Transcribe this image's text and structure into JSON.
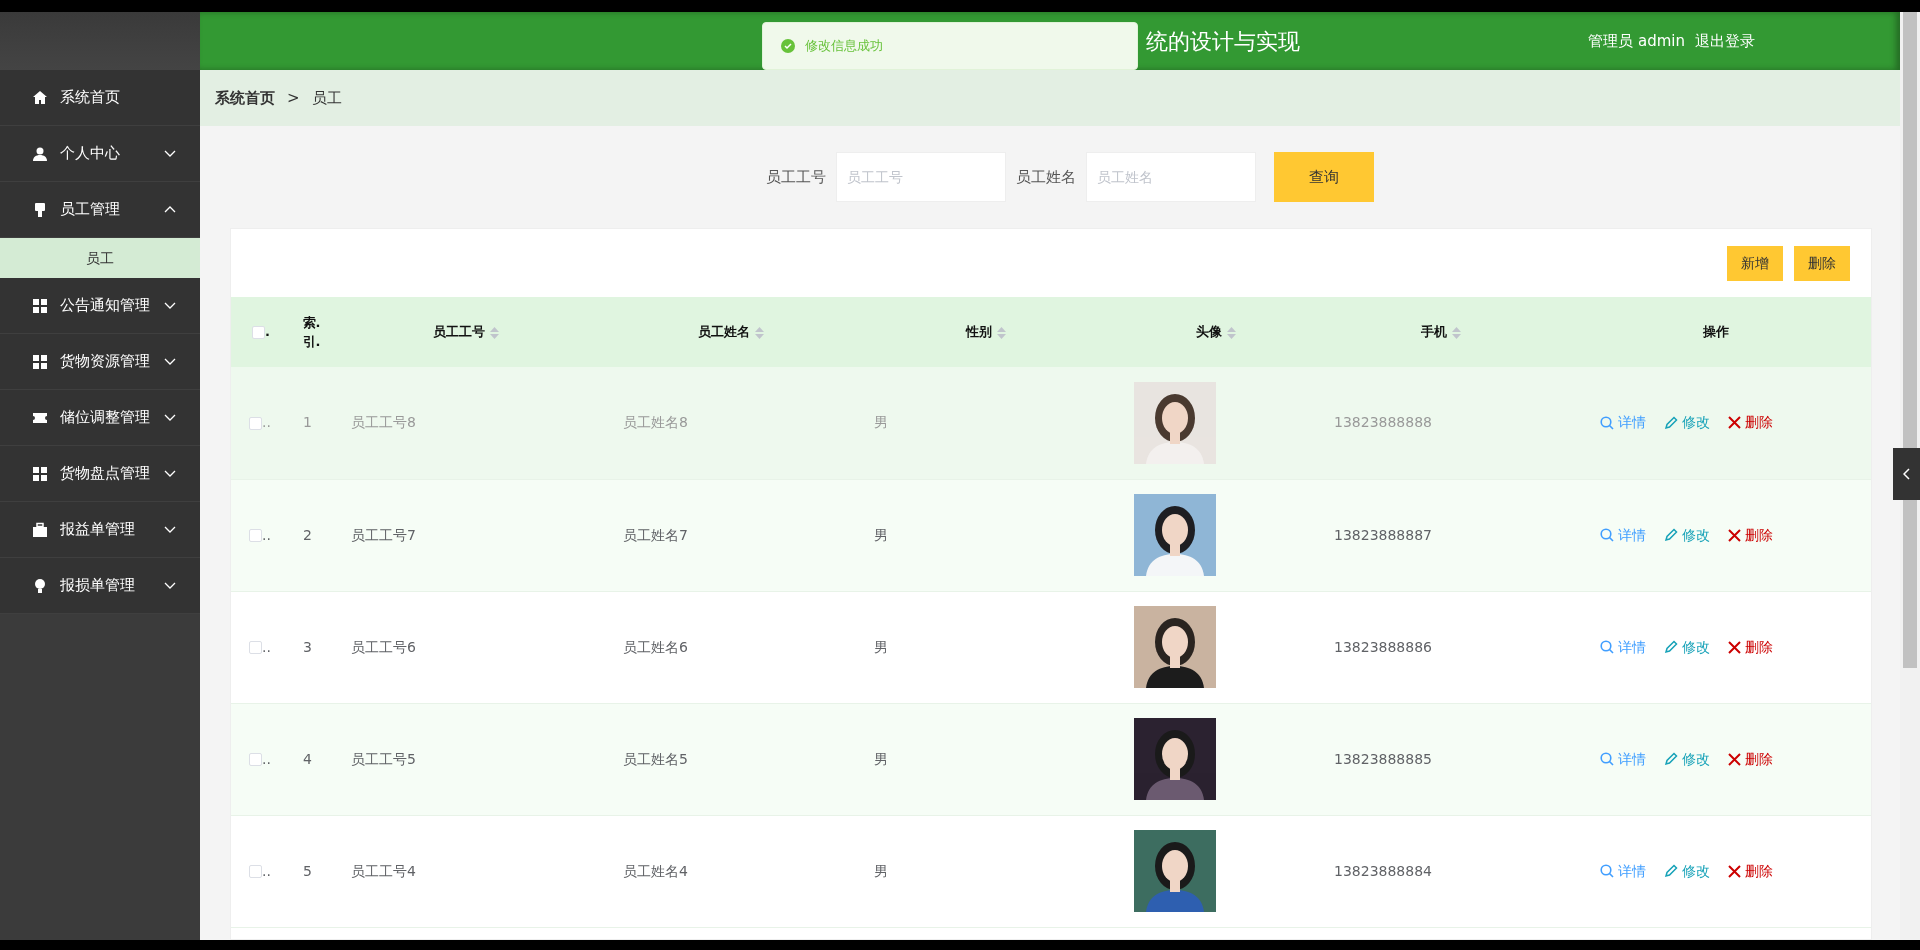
{
  "header": {
    "title": "统的设计与实现",
    "user": "管理员 admin",
    "logout": "退出登录"
  },
  "toast": {
    "kind": "success",
    "message": "修改信息成功"
  },
  "sidebar": {
    "items": [
      {
        "label": "系统首页",
        "expandable": false
      },
      {
        "label": "个人中心",
        "expandable": true,
        "expanded": false
      },
      {
        "label": "员工管理",
        "expandable": true,
        "expanded": true,
        "children": [
          {
            "label": "员工",
            "selected": true
          }
        ]
      },
      {
        "label": "公告通知管理",
        "expandable": true,
        "expanded": false
      },
      {
        "label": "货物资源管理",
        "expandable": true,
        "expanded": false
      },
      {
        "label": "储位调整管理",
        "expandable": true,
        "expanded": false
      },
      {
        "label": "货物盘点管理",
        "expandable": true,
        "expanded": false
      },
      {
        "label": "报益单管理",
        "expandable": true,
        "expanded": false
      },
      {
        "label": "报损单管理",
        "expandable": true,
        "expanded": false
      }
    ]
  },
  "breadcrumb": [
    {
      "label": "系统首页"
    },
    {
      "label": "员工"
    }
  ],
  "breadcrumb_separator": ">",
  "search": {
    "fields": [
      {
        "label": "员工工号",
        "placeholder": "员工工号"
      },
      {
        "label": "员工姓名",
        "placeholder": "员工姓名"
      }
    ],
    "button": "查询"
  },
  "toolbar": {
    "buttons": [
      "新增",
      "删除"
    ]
  },
  "table": {
    "select_all": {
      "checked": false,
      "ellipsis": "."
    },
    "columns": [
      {
        "label": "索. 引.",
        "sortable": false
      },
      {
        "label": "员工工号",
        "sortable": true
      },
      {
        "label": "员工姓名",
        "sortable": true
      },
      {
        "label": "性别",
        "sortable": true
      },
      {
        "label": "头像",
        "sortable": true
      },
      {
        "label": "手机",
        "sortable": true
      },
      {
        "label": "操作",
        "sortable": false
      }
    ],
    "rows": [
      {
        "checked": false,
        "hovered": true,
        "ellipsis": "..",
        "index": "1",
        "emp_no": "员工工号8",
        "name": "员工姓名8",
        "gender": "男",
        "phone": "13823888888",
        "actions": [
          {
            "kind": "view",
            "label": "详情"
          },
          {
            "kind": "edit",
            "label": "修改"
          },
          {
            "kind": "delete",
            "label": "删除"
          }
        ]
      },
      {
        "checked": false,
        "hovered": false,
        "ellipsis": "..",
        "index": "2",
        "emp_no": "员工工号7",
        "name": "员工姓名7",
        "gender": "男",
        "phone": "13823888887",
        "actions": [
          {
            "kind": "view",
            "label": "详情"
          },
          {
            "kind": "edit",
            "label": "修改"
          },
          {
            "kind": "delete",
            "label": "删除"
          }
        ]
      },
      {
        "checked": false,
        "hovered": false,
        "ellipsis": "..",
        "index": "3",
        "emp_no": "员工工号6",
        "name": "员工姓名6",
        "gender": "男",
        "phone": "13823888886",
        "actions": [
          {
            "kind": "view",
            "label": "详情"
          },
          {
            "kind": "edit",
            "label": "修改"
          },
          {
            "kind": "delete",
            "label": "删除"
          }
        ]
      },
      {
        "checked": false,
        "hovered": false,
        "ellipsis": "..",
        "index": "4",
        "emp_no": "员工工号5",
        "name": "员工姓名5",
        "gender": "男",
        "phone": "13823888885",
        "actions": [
          {
            "kind": "view",
            "label": "详情"
          },
          {
            "kind": "edit",
            "label": "修改"
          },
          {
            "kind": "delete",
            "label": "删除"
          }
        ]
      },
      {
        "checked": false,
        "hovered": false,
        "ellipsis": "..",
        "index": "5",
        "emp_no": "员工工号4",
        "name": "员工姓名4",
        "gender": "男",
        "phone": "13823888884",
        "actions": [
          {
            "kind": "view",
            "label": "详情"
          },
          {
            "kind": "edit",
            "label": "修改"
          },
          {
            "kind": "delete",
            "label": "删除"
          }
        ]
      }
    ]
  }
}
